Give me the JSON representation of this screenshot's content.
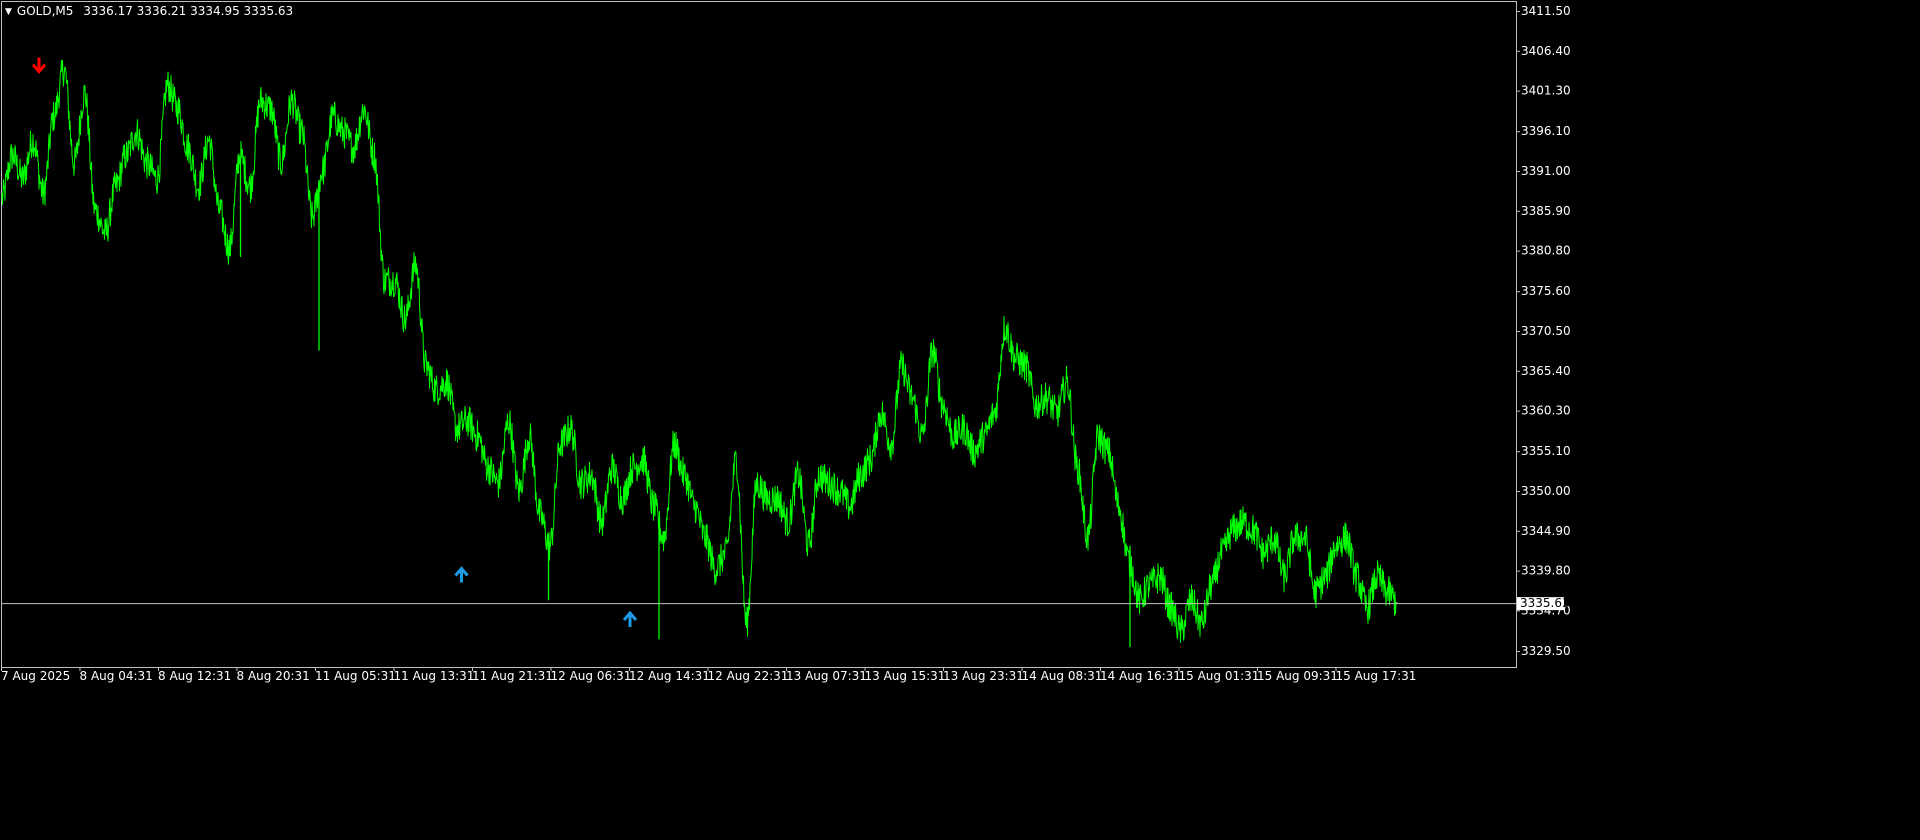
{
  "header": {
    "symbol": "GOLD,M5",
    "ohlc": "3336.17 3336.21 3334.95 3335.63"
  },
  "colors": {
    "background": "#000000",
    "series": "#00ff00",
    "axis": "#c0c0c0",
    "price_line": "#c0c0c0",
    "sell_arrow": "#ff0000",
    "buy_arrow": "#1e9be6"
  },
  "chart_data": {
    "type": "line",
    "series": [
      {
        "values": [
          3387.5,
          3393,
          3390,
          3395,
          3388,
          3398,
          3404,
          3392,
          3401,
          3386,
          3383,
          3389,
          3393,
          3396,
          3392,
          3390,
          3402,
          3399,
          3394,
          3389,
          3395,
          3386,
          3381,
          3393,
          3389,
          3400,
          3399,
          3392,
          3400,
          3396,
          3385,
          3391,
          3398,
          3396,
          3394,
          3399,
          3393,
          3377,
          3377,
          3372,
          3379,
          3366,
          3363,
          3364,
          3358,
          3359,
          3357,
          3353,
          3351,
          3359,
          3350,
          3357,
          3347,
          3343,
          3356,
          3358,
          3351,
          3352,
          3346,
          3353,
          3349,
          3353,
          3354,
          3348,
          3344,
          3356,
          3352,
          3348,
          3344,
          3340,
          3342,
          3354,
          3333,
          3351,
          3349,
          3349,
          3346,
          3352,
          3343,
          3352,
          3351,
          3350,
          3348,
          3352,
          3354,
          3360,
          3356,
          3366,
          3362,
          3357,
          3368,
          3361,
          3357,
          3358,
          3355,
          3357,
          3360,
          3371,
          3367,
          3366,
          3361,
          3362,
          3360,
          3364,
          3353,
          3344,
          3357,
          3355,
          3348,
          3341,
          3336,
          3338,
          3339,
          3335,
          3332,
          3336,
          3333,
          3338,
          3342,
          3345,
          3346,
          3345,
          3342,
          3344,
          3339,
          3344,
          3344,
          3337,
          3339,
          3343,
          3344,
          3339,
          3335,
          3339,
          3337,
          3335.6
        ],
        "low_spikes": [
          {
            "x": "8 Aug 20:31",
            "y": 3380
          },
          {
            "x": "11 Aug 05:31",
            "y": 3368
          },
          {
            "x": "12 Aug 06:31",
            "y": 3336
          },
          {
            "x": "12 Aug 14:31",
            "y": 3331
          },
          {
            "x": "14 Aug 16:31",
            "y": 3330
          }
        ]
      }
    ],
    "x_ticks": [
      "7 Aug 2025",
      "8 Aug 04:31",
      "8 Aug 12:31",
      "8 Aug 20:31",
      "11 Aug 05:31",
      "11 Aug 13:31",
      "11 Aug 21:31",
      "12 Aug 06:31",
      "12 Aug 14:31",
      "12 Aug 22:31",
      "13 Aug 07:31",
      "13 Aug 15:31",
      "13 Aug 23:31",
      "14 Aug 08:31",
      "14 Aug 16:31",
      "15 Aug 01:31",
      "15 Aug 09:31",
      "15 Aug 17:31"
    ],
    "y_ticks": [
      "3411.50",
      "3406.40",
      "3401.30",
      "3396.10",
      "3391.00",
      "3385.90",
      "3380.80",
      "3375.60",
      "3370.50",
      "3365.40",
      "3360.30",
      "3355.10",
      "3350.00",
      "3344.90",
      "3339.80",
      "3334.70",
      "3329.50"
    ],
    "ylim": [
      3327.2,
      3412.6
    ],
    "current_price": 3335.63,
    "current_price_label": "3335.63",
    "signals": [
      {
        "type": "sell",
        "x": "7 Aug 2025",
        "y": 3404.5
      },
      {
        "type": "buy",
        "x": "11 Aug 13:31",
        "y": 3339.3
      },
      {
        "type": "buy",
        "x": "12 Aug 14:31",
        "y": 3333.6
      }
    ]
  }
}
